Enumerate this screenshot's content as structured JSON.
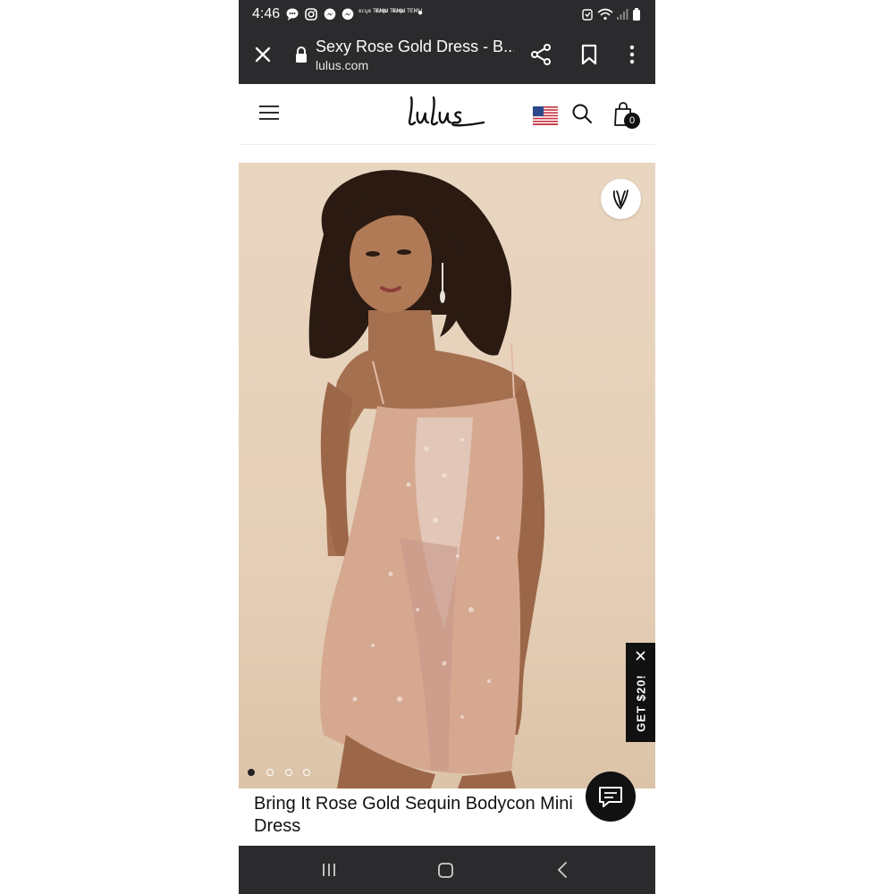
{
  "status_bar": {
    "time": "4:46",
    "notification_mini_labels": [
      "ɐɾɥɐ TEMU",
      "ɐɾɥɐ TEMU",
      "ɐɾɥɐ TEMU"
    ],
    "icons": [
      "chat-bubble-icon",
      "instagram-icon",
      "messenger-icon",
      "messenger-icon",
      "alarm-icon",
      "wifi-icon",
      "signal-icon",
      "battery-icon"
    ]
  },
  "browser": {
    "page_title": "Sexy Rose Gold Dress - B...",
    "url": "lulus.com"
  },
  "site": {
    "logo_text": "lulus",
    "cart_count": "0",
    "flag": "us-flag-icon"
  },
  "product": {
    "title": "Bring It Rose Gold Sequin Bodycon Mini Dress",
    "carousel": {
      "total": 4,
      "active_index": 0
    },
    "promo_label": "GET $20!"
  },
  "colors": {
    "bar_bg": "#2b2b2d",
    "image_bg": "#e5cfb7",
    "dress": "#d6a890",
    "accent_dark": "#111111"
  }
}
